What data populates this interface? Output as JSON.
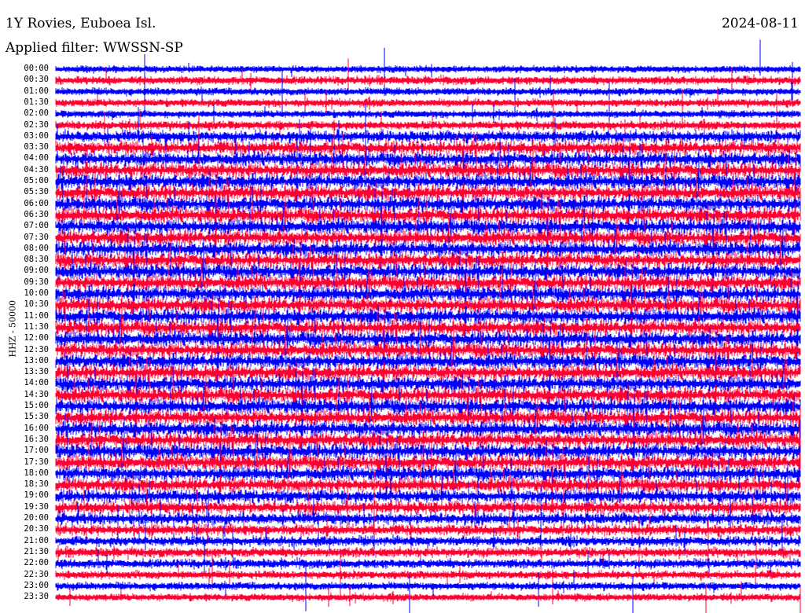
{
  "header": {
    "station": "1Y Rovies, Euboea Isl.",
    "date": "2024-08-11",
    "filter": "Applied filter: WWSSN-SP"
  },
  "chart_data": {
    "type": "line",
    "title": "1Y Rovies, Euboea Isl.",
    "subtitle": "Applied filter: WWSSN-SP",
    "ylabel": "HHZ - 50000",
    "xlabel": "",
    "row_labels": [
      "00:00",
      "00:30",
      "01:00",
      "01:30",
      "02:00",
      "02:30",
      "03:00",
      "03:30",
      "04:00",
      "04:30",
      "05:00",
      "05:30",
      "06:00",
      "06:30",
      "07:00",
      "07:30",
      "08:00",
      "08:30",
      "09:00",
      "09:30",
      "10:00",
      "10:30",
      "11:00",
      "11:30",
      "12:00",
      "12:30",
      "13:00",
      "13:30",
      "14:00",
      "14:30",
      "15:00",
      "15:30",
      "16:00",
      "16:30",
      "17:00",
      "17:30",
      "18:00",
      "18:30",
      "19:00",
      "19:30",
      "20:00",
      "20:30",
      "21:00",
      "21:30",
      "22:00",
      "22:30",
      "23:00",
      "23:30"
    ],
    "series_colors": [
      "#0000ff",
      "#ff0033"
    ],
    "relative_activity": [
      0.15,
      0.3,
      0.2,
      0.25,
      0.2,
      0.35,
      0.7,
      0.9,
      0.9,
      1,
      1,
      1,
      1,
      1,
      1,
      1,
      1,
      1,
      1,
      1,
      1,
      1,
      1,
      1,
      1,
      1,
      1,
      1,
      1,
      1,
      1,
      1,
      1,
      1,
      1,
      1,
      0.9,
      0.9,
      0.8,
      0.8,
      0.7,
      0.6,
      0.5,
      0.45,
      0.4,
      0.3,
      0.25,
      0.2
    ]
  }
}
